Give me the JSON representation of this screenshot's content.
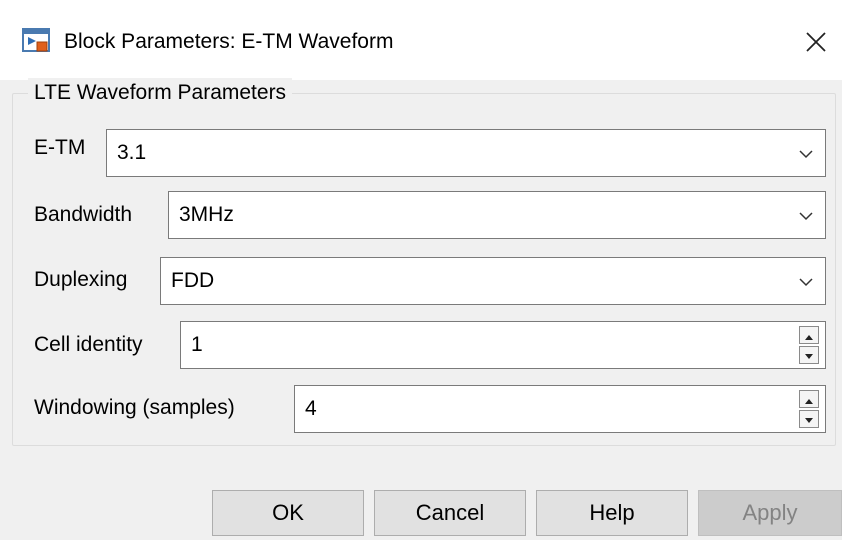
{
  "window": {
    "title": "Block Parameters: E-TM Waveform",
    "close_icon": "close-icon",
    "app_icon": "simulink-block-icon"
  },
  "group": {
    "legend": "LTE Waveform Parameters"
  },
  "fields": {
    "etm": {
      "label": "E-TM",
      "value": "3.1",
      "kind": "dropdown"
    },
    "bandwidth": {
      "label": "Bandwidth",
      "value": "3MHz",
      "kind": "dropdown"
    },
    "duplexing": {
      "label": "Duplexing",
      "value": "FDD",
      "kind": "dropdown"
    },
    "cell_identity": {
      "label": "Cell identity",
      "value": "1",
      "kind": "spinner"
    },
    "windowing": {
      "label": "Windowing (samples)",
      "value": "4",
      "kind": "spinner"
    }
  },
  "buttons": {
    "ok": "OK",
    "cancel": "Cancel",
    "help": "Help",
    "apply": "Apply",
    "apply_enabled": false
  }
}
